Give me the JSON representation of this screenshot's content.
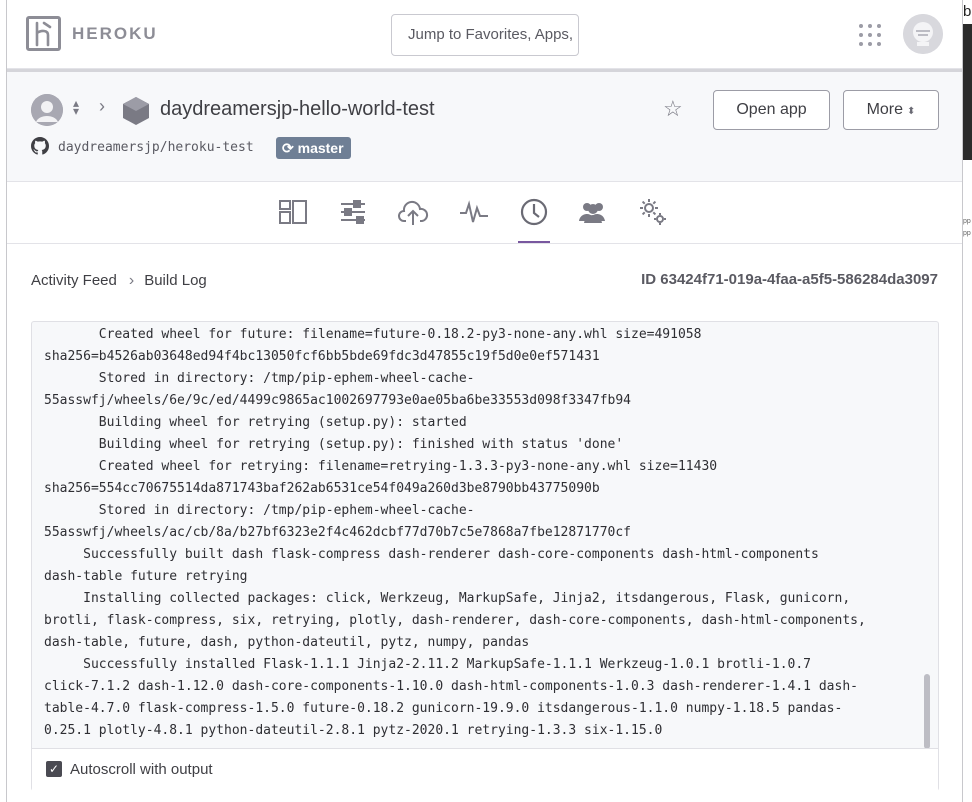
{
  "topbar": {
    "brand": "HEROKU",
    "search_placeholder": "Jump to Favorites, Apps, Pipelines, Spaces..."
  },
  "app_header": {
    "app_name": "daydreamersjp-hello-world-test",
    "open_app_label": "Open app",
    "more_label": "More",
    "repo": "daydreamersjp/heroku-test",
    "branch": "master"
  },
  "tabs": [
    {
      "name": "overview",
      "icon": "overview-icon"
    },
    {
      "name": "resources",
      "icon": "resources-icon"
    },
    {
      "name": "deploy",
      "icon": "deploy-icon"
    },
    {
      "name": "metrics",
      "icon": "metrics-icon"
    },
    {
      "name": "activity",
      "icon": "activity-clock-icon",
      "active": true
    },
    {
      "name": "access",
      "icon": "access-people-icon"
    },
    {
      "name": "settings",
      "icon": "settings-gear-icon"
    }
  ],
  "breadcrumb": {
    "parent": "Activity Feed",
    "current": "Build Log"
  },
  "build_id": "ID 63424f71-019a-4faa-a5f5-586284da3097",
  "log_lines": [
    "       Created wheel for future: filename=future-0.18.2-py3-none-any.whl size=491058",
    "sha256=b4526ab03648ed94f4bc13050fcf6bb5bde69fdc3d47855c19f5d0e0ef571431",
    "       Stored in directory: /tmp/pip-ephem-wheel-cache-",
    "55asswfj/wheels/6e/9c/ed/4499c9865ac1002697793e0ae05ba6be33553d098f3347fb94",
    "       Building wheel for retrying (setup.py): started",
    "       Building wheel for retrying (setup.py): finished with status 'done'",
    "       Created wheel for retrying: filename=retrying-1.3.3-py3-none-any.whl size=11430",
    "sha256=554cc70675514da871743baf262ab6531ce54f049a260d3be8790bb43775090b",
    "       Stored in directory: /tmp/pip-ephem-wheel-cache-",
    "55asswfj/wheels/ac/cb/8a/b27bf6323e2f4c462dcbf77d70b7c5e7868a7fbe12871770cf",
    "     Successfully built dash flask-compress dash-renderer dash-core-components dash-html-components",
    "dash-table future retrying",
    "     Installing collected packages: click, Werkzeug, MarkupSafe, Jinja2, itsdangerous, Flask, gunicorn,",
    "brotli, flask-compress, six, retrying, plotly, dash-renderer, dash-core-components, dash-html-components,",
    "dash-table, future, dash, python-dateutil, pytz, numpy, pandas",
    "     Successfully installed Flask-1.1.1 Jinja2-2.11.2 MarkupSafe-1.1.1 Werkzeug-1.0.1 brotli-1.0.7",
    "click-7.1.2 dash-1.12.0 dash-core-components-1.10.0 dash-html-components-1.0.3 dash-renderer-1.4.1 dash-",
    "table-4.7.0 flask-compress-1.5.0 future-0.18.2 gunicorn-19.9.0 itsdangerous-1.1.0 numpy-1.18.5 pandas-",
    "0.25.1 plotly-4.8.1 python-dateutil-2.8.1 pytz-2020.1 retrying-1.3.3 six-1.15.0"
  ],
  "autoscroll": {
    "label": "Autoscroll with output",
    "checked": true
  },
  "colors": {
    "accent": "#79589f",
    "branch_badge": "#6f7f95",
    "icon_gray": "#7a7a84"
  }
}
